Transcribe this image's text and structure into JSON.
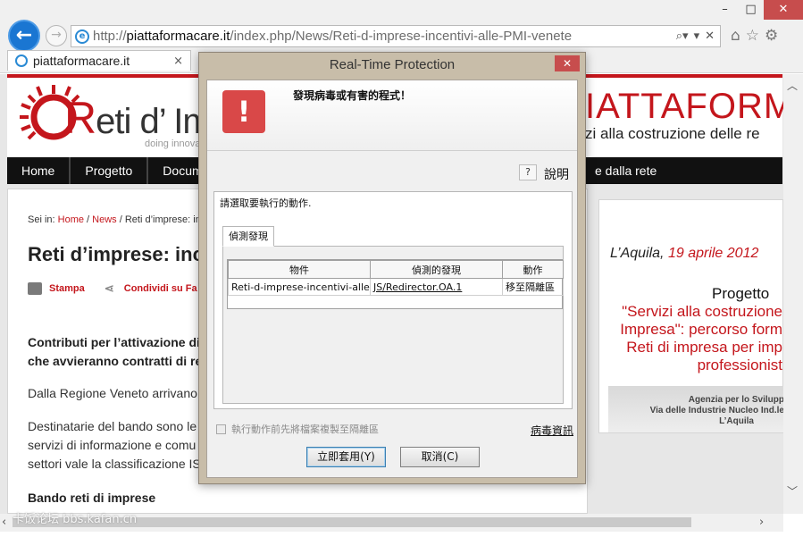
{
  "browser": {
    "window_controls": [
      "–",
      "□",
      "✕"
    ],
    "address": {
      "prefix": "http://",
      "host": "piattaformacare.it",
      "path": "/index.php/News/Reti-d-imprese-incentivi-alle-PMI-venete"
    },
    "tab": {
      "label": "piattaformacare.it",
      "close": "×"
    },
    "icons": [
      "back-icon",
      "forward-icon",
      "search-icon",
      "refresh-icon",
      "home-icon",
      "favorites-icon",
      "settings-icon"
    ]
  },
  "site": {
    "logo_prefix": "R",
    "logo_text": "eti d’ Impre",
    "logo_tagline": "doing innova",
    "brand_right": "IATTAFORMA",
    "brand_sub": "zi alla costruzione delle re",
    "nav": [
      "Home",
      "Progetto",
      "Docume",
      "e dalla rete"
    ],
    "breadcrumb": {
      "prefix": "Sei in: ",
      "home": "Home",
      "sep1": " / ",
      "news": "News",
      "sep2": " / ",
      "current": "Reti d’imprese: in"
    },
    "title": "Reti d’imprese: inc",
    "actions": {
      "print": "Stampa",
      "share": "Condividi su Fa"
    },
    "paragraphs": [
      "Contributi per l’attivazione di",
      "che avvieranno contratti di re",
      "Dalla Regione Veneto arrivano",
      "Destinatarie del bando sono le",
      "servizi di informazione e comu",
      "settori vale la classificazione IS",
      "Bando reti di imprese"
    ],
    "sidebar": {
      "place": "L’Aquila,",
      "date": "19 aprile 2012",
      "project_label": "Progetto",
      "red_lines": [
        "\"Servizi alla costruzione",
        "Impresa\": percorso form",
        "Reti di impresa per imp",
        "professionist"
      ],
      "box_lines": [
        "Agenzia per lo Svilupp",
        "Via delle Industrie Nucleo Ind.le",
        "L’Aquila"
      ]
    }
  },
  "dialog": {
    "title": "Real-Time Protection",
    "close": "✕",
    "alert_icon": "!",
    "message": "發現病毒或有害的程式！",
    "help_icon": "?",
    "help_label": "說明",
    "instruction": "請選取要執行的動作.",
    "tab_label": "偵測發現",
    "columns": [
      "物件",
      "偵測的發現",
      "動作"
    ],
    "rows": [
      {
        "object": "Reti-d-imprese-incentivi-alle-...",
        "detection": "JS/Redirector.OA.1",
        "action": "移至隔離區"
      }
    ],
    "checkbox_label": "執行動作前先將檔案複製至隔離區",
    "virus_info": "病毒資訊",
    "apply_button": "立即套用(Y)",
    "cancel_button": "取消(C)"
  },
  "watermark": "卡饭论坛 bbs.kafan.cn",
  "colors": {
    "accent_red": "#c4161c",
    "alert_red": "#d94848",
    "nav_black": "#111111",
    "link_blue": "#2a6fcf"
  }
}
